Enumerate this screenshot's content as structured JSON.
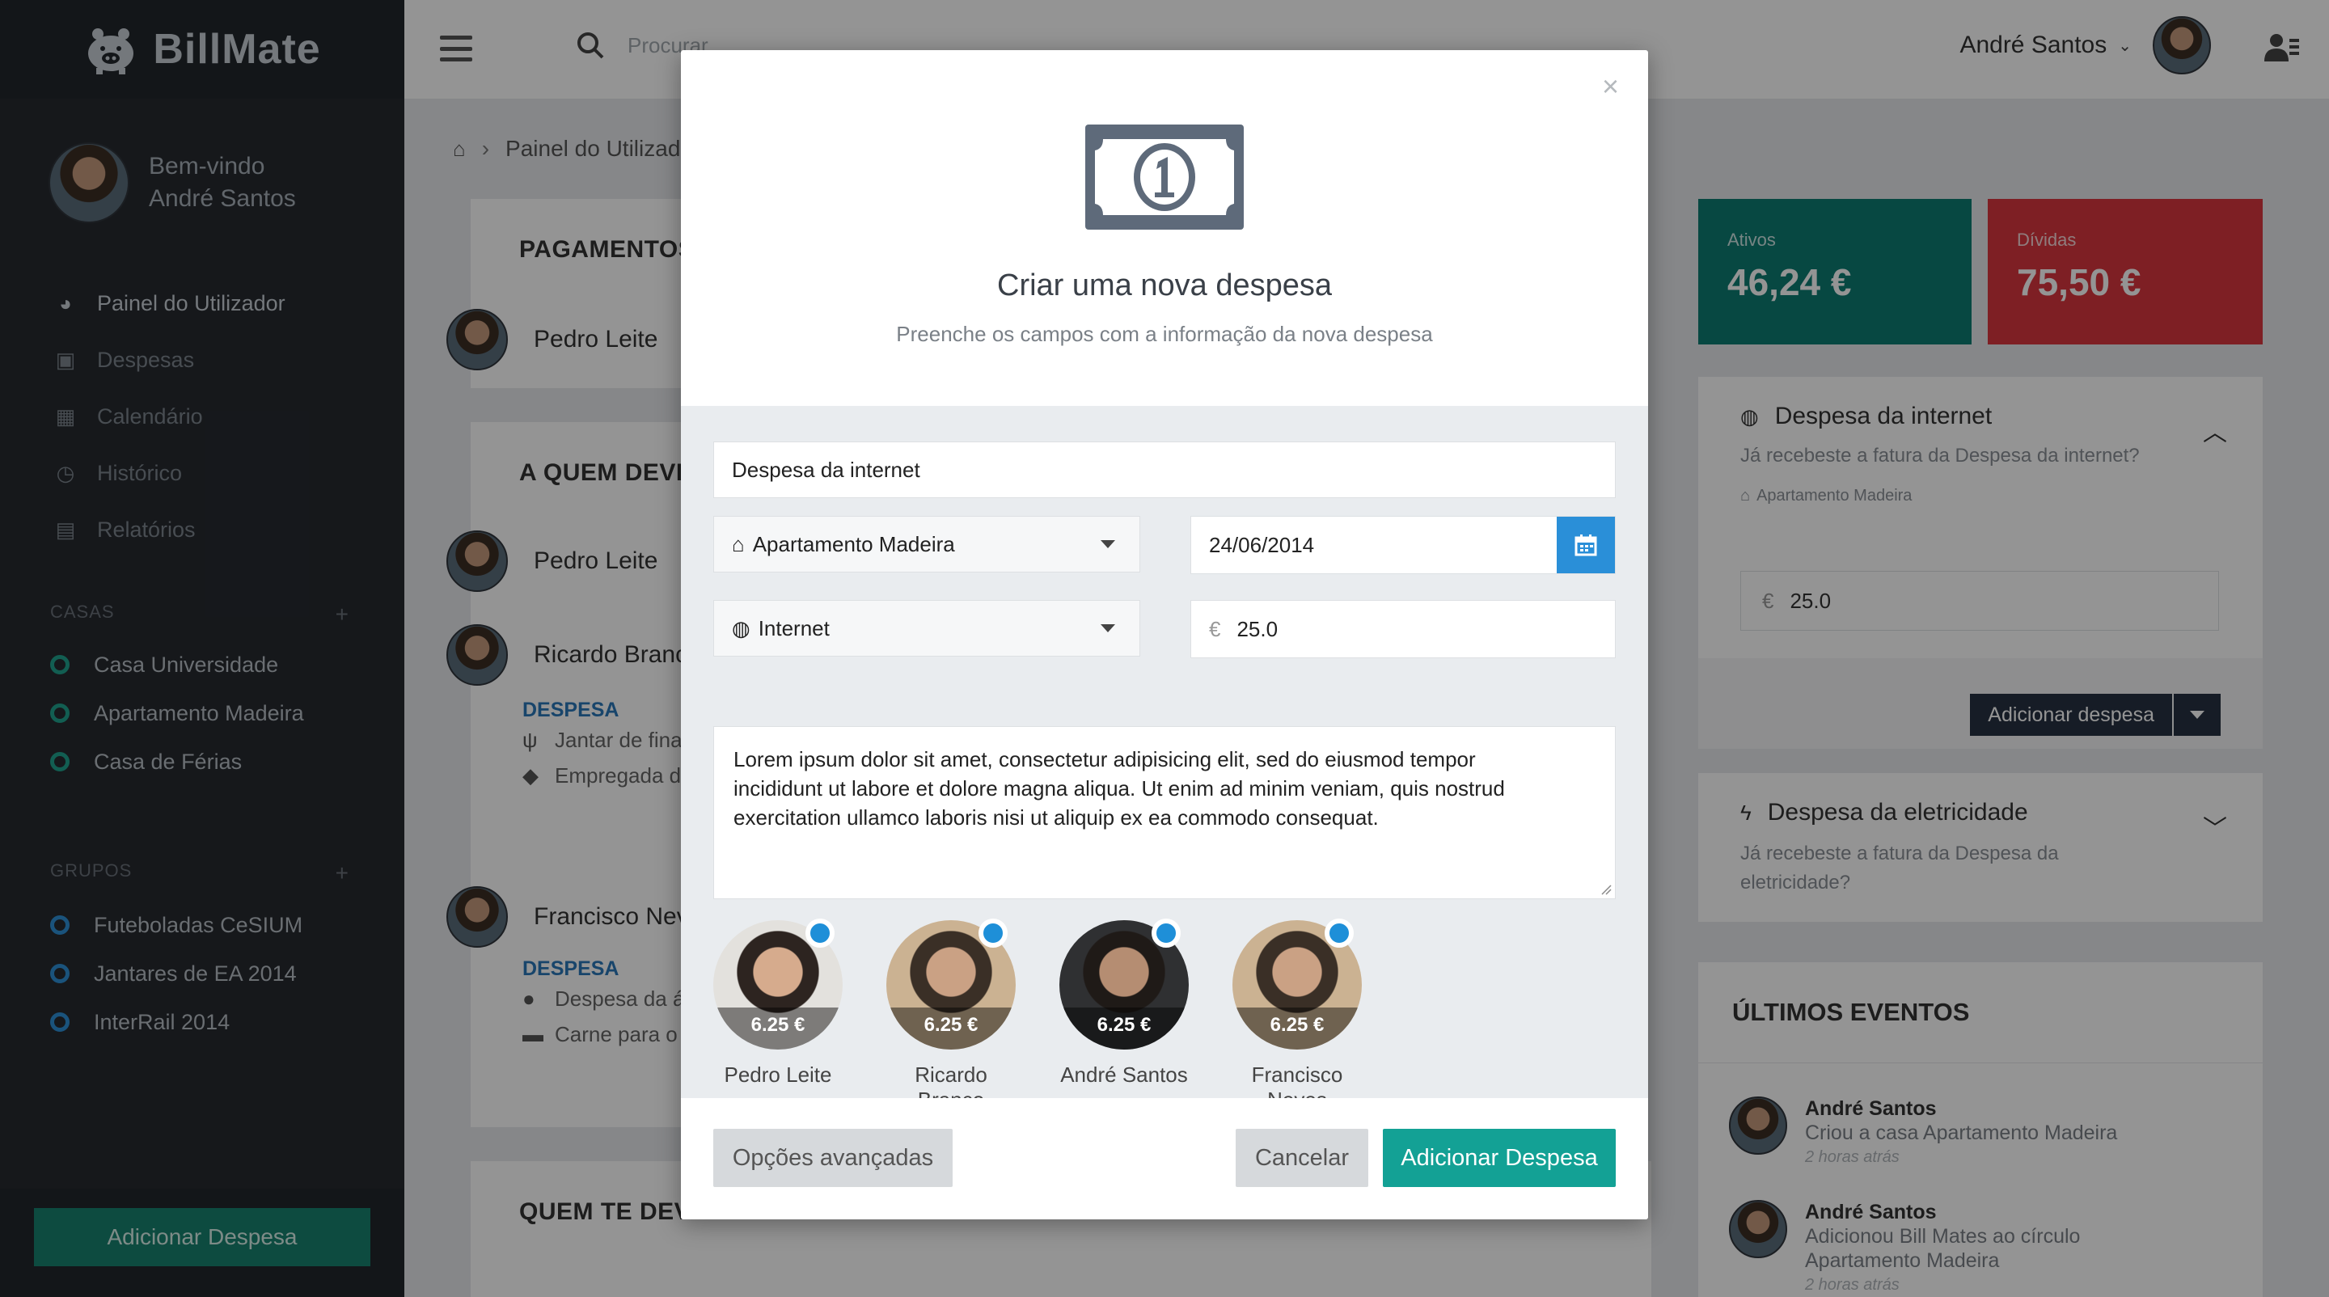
{
  "brand": {
    "name": "BillMate"
  },
  "sidebar": {
    "welcome": "Bem-vindo",
    "user_name": "André Santos",
    "nav": [
      {
        "label": "Painel do Utilizador",
        "icon": "dashboard-icon"
      },
      {
        "label": "Despesas",
        "icon": "money-icon"
      },
      {
        "label": "Calendário",
        "icon": "calendar-icon"
      },
      {
        "label": "Histórico",
        "icon": "clock-icon"
      },
      {
        "label": "Relatórios",
        "icon": "document-icon"
      }
    ],
    "casas_title": "CASAS",
    "casas": [
      "Casa Universidade",
      "Apartamento Madeira",
      "Casa de Férias"
    ],
    "grupos_title": "GRUPOS",
    "grupos": [
      "Futeboladas CeSIUM",
      "Jantares de EA 2014",
      "InterRail 2014"
    ],
    "add_symbol": "+",
    "add_button": "Adicionar Despesa"
  },
  "topbar": {
    "search_placeholder": "Procurar",
    "user_name": "André Santos"
  },
  "breadcrumb": {
    "current": "Painel do Utilizador"
  },
  "main": {
    "pagamentos_title": "PAGAMENTOS",
    "pagamentos_person": "Pedro Leite",
    "a_quem_title": "A QUEM DEVES",
    "a_quem_people": [
      "Pedro Leite",
      "Ricardo Branco",
      "Francisco Neves"
    ],
    "despesa_label": "DESPESA",
    "ricardo_items": [
      "Jantar de final",
      "Empregada de"
    ],
    "francisco_items": [
      "Despesa da água",
      "Carne para o"
    ],
    "quem_te_title": "QUEM TE DEVE"
  },
  "stats": {
    "ativos_label": "Ativos",
    "ativos_value": "46,24 €",
    "dividas_label": "Dívidas",
    "dividas_value": "75,50 €"
  },
  "right": {
    "internet_title": "Despesa da internet",
    "internet_question": "Já recebeste a fatura da Despesa da internet?",
    "internet_house": "Apartamento Madeira",
    "currency": "€",
    "internet_amount": "25.0",
    "add_btn": "Adicionar despesa",
    "eletric_title": "Despesa da eletricidade",
    "eletric_question": "Já recebeste a fatura da Despesa da eletricidade?",
    "events_title": "ÚLTIMOS EVENTOS",
    "events": [
      {
        "user": "André Santos",
        "text": "Criou a casa Apartamento Madeira",
        "time": "2 horas atrás"
      },
      {
        "user": "André Santos",
        "text": "Adicionou Bill Mates ao círculo Apartamento Madeira",
        "time": "2 horas atrás"
      }
    ]
  },
  "modal": {
    "close": "×",
    "title": "Criar uma nova despesa",
    "subtitle": "Preenche os campos com a informação da nova despesa",
    "name_value": "Despesa da internet",
    "house_value": "Apartamento Madeira",
    "date_value": "24/06/2014",
    "category_value": "Internet",
    "currency": "€",
    "amount_value": "25.0",
    "description": "Lorem ipsum dolor sit amet, consectetur adipisicing elit, sed do eiusmod tempor incididunt ut labore et dolore magna aliqua. Ut enim ad minim veniam, quis nostrud exercitation ullamco laboris nisi ut aliquip ex ea commodo consequat.",
    "participants": [
      {
        "name": "Pedro Leite",
        "amount": "6.25 €"
      },
      {
        "name": "Ricardo Branco",
        "amount": "6.25 €"
      },
      {
        "name": "André Santos",
        "amount": "6.25 €"
      },
      {
        "name": "Francisco Neves",
        "amount": "6.25 €"
      }
    ],
    "advanced_btn": "Opções avançadas",
    "cancel_btn": "Cancelar",
    "submit_btn": "Adicionar Despesa"
  },
  "colors": {
    "teal": "#13a195",
    "ativos_bg": "#0d7d73",
    "dividas_bg": "#d9363e",
    "accent_blue": "#2a8fd8",
    "sidebar_bg": "#262a30"
  }
}
